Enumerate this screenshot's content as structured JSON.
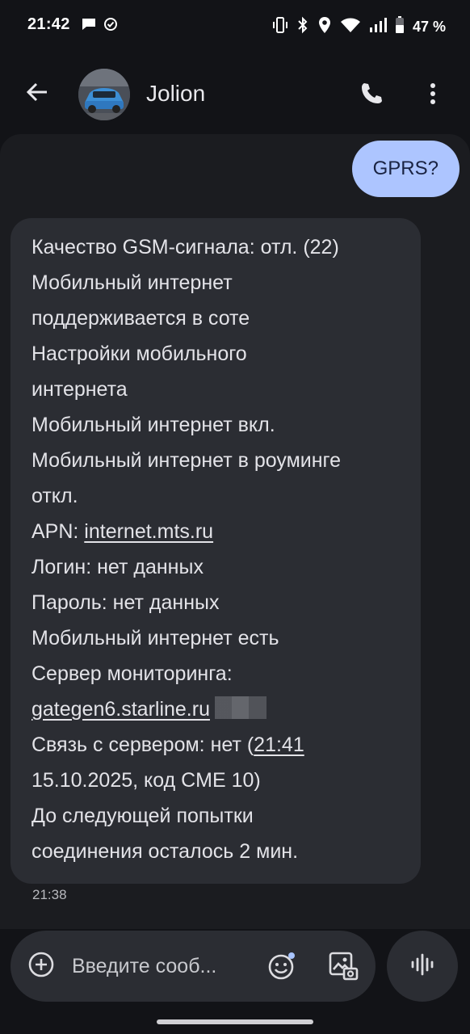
{
  "status_bar": {
    "time": "21:42",
    "battery_percent": "47 %",
    "icons_left": [
      "chat-bubble-icon",
      "check-circle-icon"
    ],
    "icons_right": [
      "vibrate-icon",
      "bluetooth-icon",
      "location-icon",
      "wifi-icon",
      "signal-icon",
      "battery-icon"
    ]
  },
  "header": {
    "contact_name": "Jolion",
    "back_icon": "arrow-back-icon",
    "call_icon": "phone-icon",
    "menu_icon": "more-vert-icon"
  },
  "messages": {
    "outgoing": {
      "text": "GPRS?"
    },
    "incoming": {
      "lines": [
        "Качество GSM-сигнала: отл. (22)",
        "Мобильный интернет",
        "поддерживается в соте",
        "Настройки мобильного",
        "интернета",
        "Мобильный интернет вкл.",
        "Мобильный интернет в роуминге",
        "откл.",
        "APN: ",
        "internet.mts.ru",
        "Логин: нет данных",
        "Пароль: нет данных",
        "Мобильный интернет есть",
        "Сервер мониторинга:",
        "gategen6.starline.ru",
        "Связь с сервером: нет (",
        "21:41",
        "15.10.2025, код CME 10)",
        "До следующей попытки",
        "соединения осталось 2 мин."
      ],
      "time": "21:38"
    }
  },
  "composer": {
    "placeholder": "Введите сооб...",
    "add_icon": "add-circle-icon",
    "emoji_icon": "emoji-icon",
    "gallery_icon": "gallery-icon",
    "voice_icon": "voice-waveform-icon"
  },
  "colors": {
    "background": "#121317",
    "conversation_bg": "#1b1c20",
    "incoming_bubble": "#2b2d33",
    "outgoing_bubble": "#adc5ff",
    "outgoing_text": "#1a2342"
  }
}
